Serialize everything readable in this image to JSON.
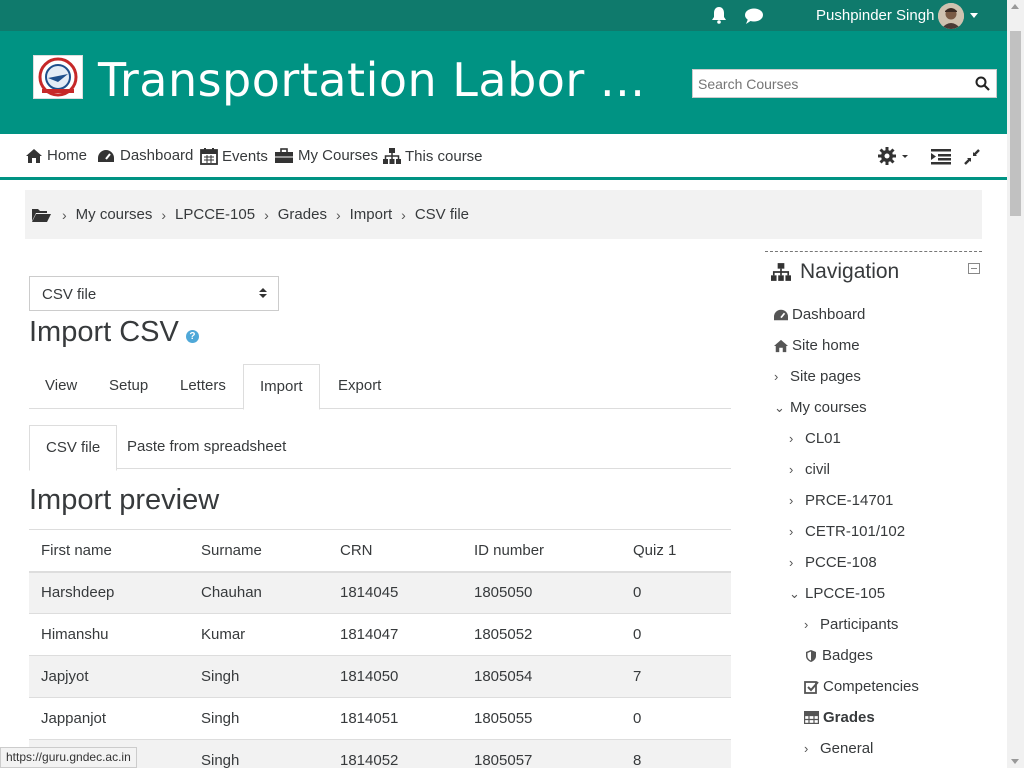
{
  "topbar": {
    "user_name": "Pushpinder Singh"
  },
  "header": {
    "site_title": "Transportation Labor ...",
    "search_placeholder": "Search Courses"
  },
  "navbar": {
    "home": "Home",
    "dashboard": "Dashboard",
    "events": "Events",
    "my_courses": "My Courses",
    "this_course": "This course"
  },
  "breadcrumb": [
    "My courses",
    "LPCCE-105",
    "Grades",
    "Import",
    "CSV file"
  ],
  "main": {
    "select_value": "CSV file",
    "page_title": "Import CSV",
    "tabs": [
      "View",
      "Setup",
      "Letters",
      "Import",
      "Export"
    ],
    "subtabs": [
      "CSV file",
      "Paste from spreadsheet"
    ],
    "section_title": "Import preview",
    "table": {
      "headers": [
        "First name",
        "Surname",
        "CRN",
        "ID number",
        "Quiz 1"
      ],
      "rows": [
        [
          "Harshdeep",
          "Chauhan",
          "1814045",
          "1805050",
          "0"
        ],
        [
          "Himanshu",
          "Kumar",
          "1814047",
          "1805052",
          "0"
        ],
        [
          "Japjyot",
          "Singh",
          "1814050",
          "1805054",
          "7"
        ],
        [
          "Jappanjot",
          "Singh",
          "1814051",
          "1805055",
          "0"
        ],
        [
          "",
          "Singh",
          "1814052",
          "1805057",
          "8"
        ]
      ]
    }
  },
  "navigation": {
    "title": "Navigation",
    "items": {
      "dashboard": "Dashboard",
      "site_home": "Site home",
      "site_pages": "Site pages",
      "my_courses": "My courses",
      "cl01": "CL01",
      "civil": "civil",
      "prce": "PRCE-14701",
      "cetr": "CETR-101/102",
      "pcce": "PCCE-108",
      "lpcce": "LPCCE-105",
      "participants": "Participants",
      "badges": "Badges",
      "competencies": "Competencies",
      "grades": "Grades",
      "general": "General"
    }
  },
  "status_url": "https://guru.gndec.ac.in",
  "colors": {
    "brand": "#009383",
    "topbar": "#0f7a6c"
  }
}
